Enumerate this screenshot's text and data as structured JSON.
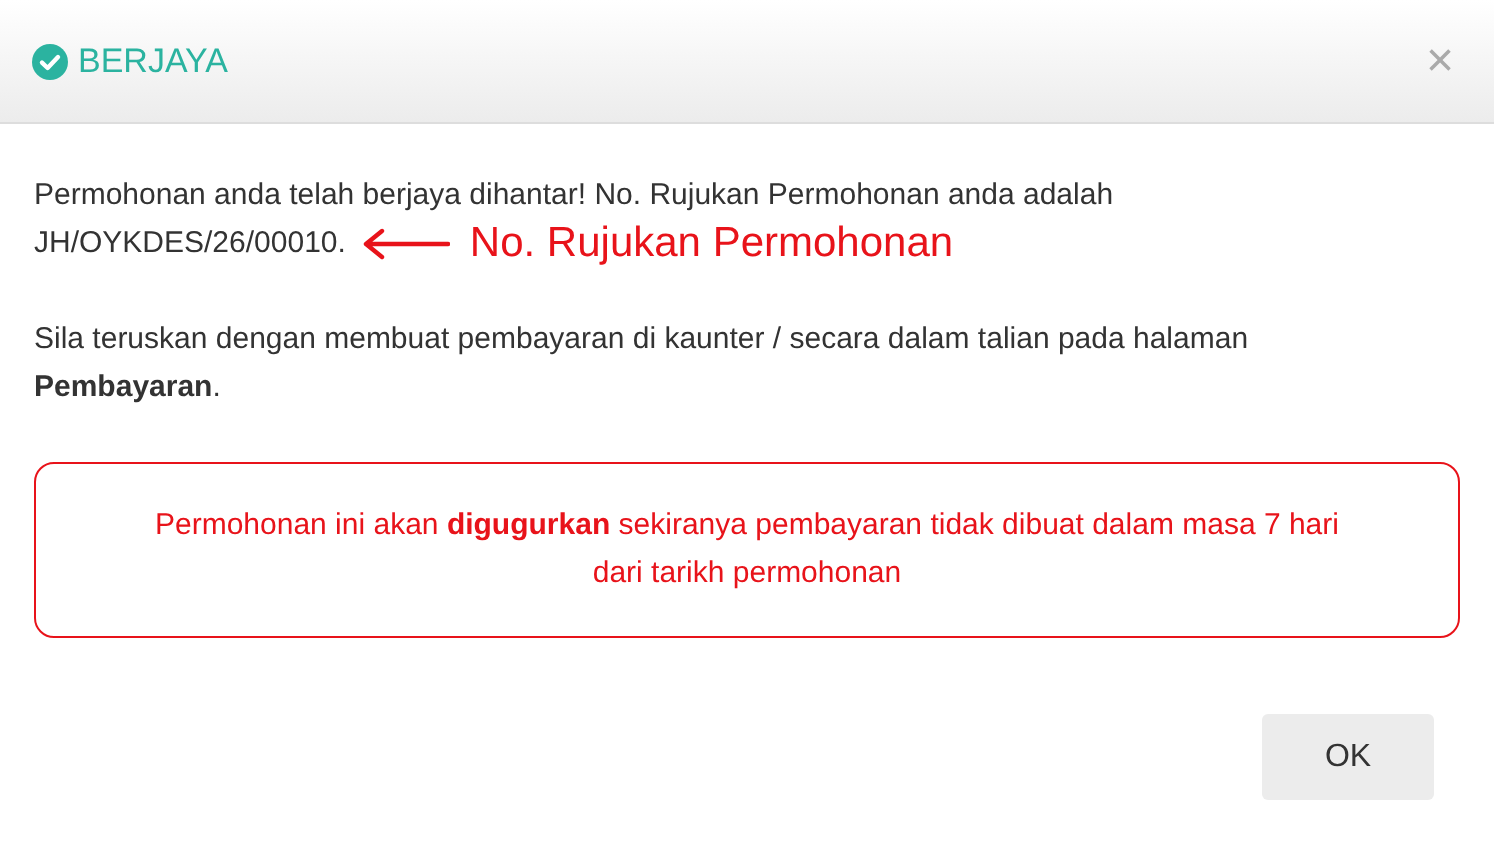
{
  "dialog": {
    "title": "BERJAYA",
    "close": "×",
    "message": "Permohonan anda telah berjaya dihantar! No. Rujukan Permohonan anda adalah",
    "reference": "JH/OYKDES/26/00010.",
    "annotation": "No. Rujukan Permohonan",
    "instruction": "Sila teruskan dengan membuat pembayaran di kaunter / secara dalam talian pada halaman **Pembayaran**.",
    "warning": "Permohonan ini akan **digugurkan** sekiranya pembayaran tidak dibuat dalam masa 7 hari dari tarikh permohonan",
    "buttons": [
      "OK"
    ]
  }
}
